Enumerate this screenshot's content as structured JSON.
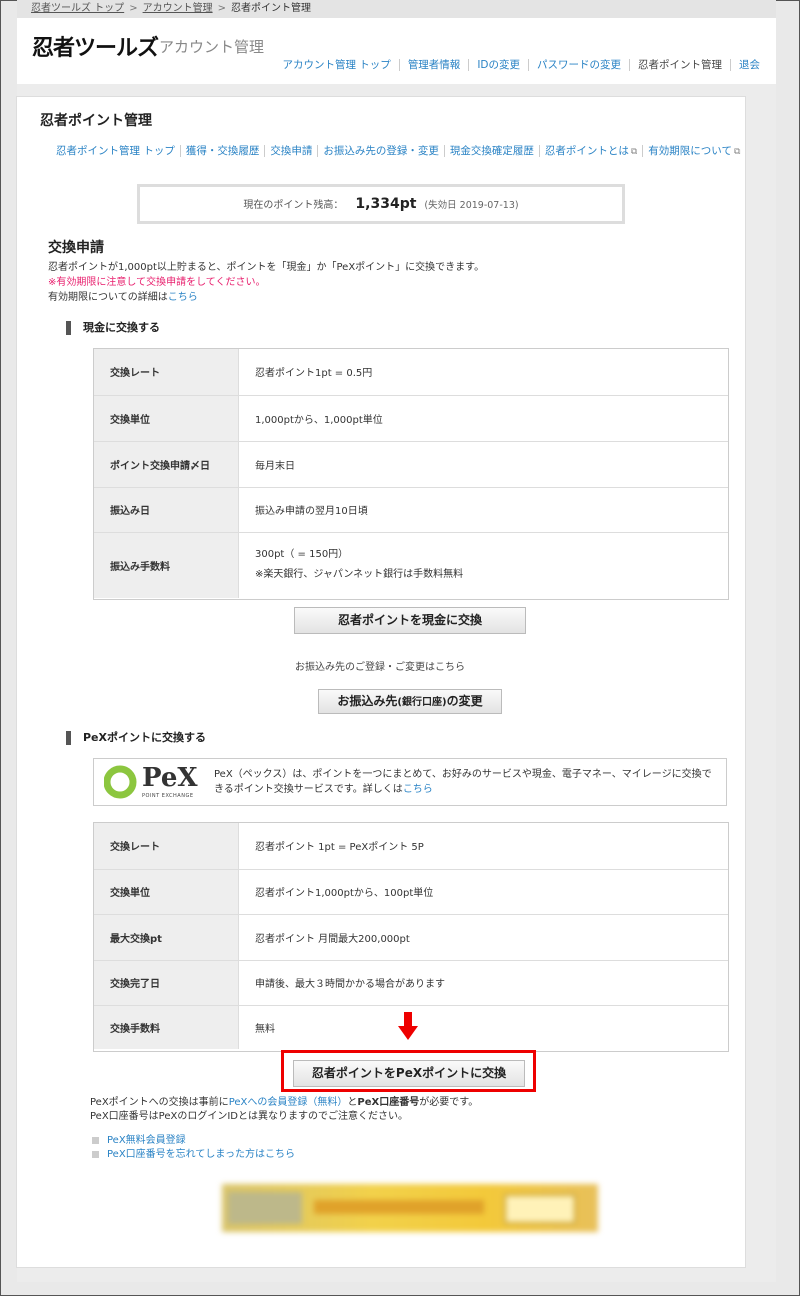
{
  "breadcrumb": {
    "items": [
      "忍者ツールズ トップ",
      "アカウント管理",
      "忍者ポイント管理"
    ],
    "sep": ">"
  },
  "header": {
    "logo": "忍者ツールズ",
    "subtitle": "アカウント管理",
    "nav": [
      "アカウント管理 トップ",
      "管理者情報",
      "IDの変更",
      "パスワードの変更",
      "忍者ポイント管理",
      "退会"
    ]
  },
  "panel": {
    "title": "忍者ポイント管理",
    "subnav": [
      "忍者ポイント管理 トップ",
      "獲得・交換履歴",
      "交換申請",
      "お振込み先の登録・変更",
      "現金交換確定履歴",
      "忍者ポイントとは",
      "有効期限について"
    ]
  },
  "balance": {
    "label": "現在のポイント残高：",
    "value": "1,334pt",
    "expiry": "(失効日 2019-07-13)"
  },
  "exchange": {
    "title": "交換申請",
    "intro1": "忍者ポイントが1,000pt以上貯まると、ポイントを「現金」か「PeXポイント」に交換できます。",
    "intro2": "※有効期限に注意して交換申請をしてください。",
    "intro3_prefix": "有効期限についての詳細は",
    "intro3_link": "こちら"
  },
  "cash": {
    "heading": "現金に交換する",
    "rows": [
      {
        "k": "交換レート",
        "v": "忍者ポイント1pt = 0.5円"
      },
      {
        "k": "交換単位",
        "v": "1,000ptから、1,000pt単位"
      },
      {
        "k": "ポイント交換申請〆日",
        "v": "毎月末日"
      },
      {
        "k": "振込み日",
        "v": "振込み申請の翌月10日頃"
      },
      {
        "k": "振込み手数料",
        "v": "300pt（ = 150円）",
        "v2": "※楽天銀行、ジャパンネット銀行は手数料無料"
      }
    ],
    "button": "忍者ポイントを現金に交換",
    "note": "お振込み先のご登録・ご変更はこちら",
    "button2_a": "お振込み先",
    "button2_b": "(銀行口座)",
    "button2_c": "の変更"
  },
  "pex": {
    "heading": "PeXポイントに交換する",
    "logo_text": "PeX",
    "logo_sub": "POINT EXCHANGE",
    "desc": "PeX（ペックス）は、ポイントを一つにまとめて、お好みのサービスや現金、電子マネー、マイレージに交換できるポイント交換サービスです。詳しくは",
    "desc_link": "こちら",
    "rows": [
      {
        "k": "交換レート",
        "v": "忍者ポイント 1pt = PeXポイント 5P"
      },
      {
        "k": "交換単位",
        "v": "忍者ポイント1,000ptから、100pt単位"
      },
      {
        "k": "最大交換pt",
        "v": "忍者ポイント 月間最大200,000pt"
      },
      {
        "k": "交換完了日",
        "v": "申請後、最大３時間かかる場合があります"
      },
      {
        "k": "交換手数料",
        "v": "無料"
      }
    ],
    "button": "忍者ポイントをPeXポイントに交換",
    "note1_a": "PeXポイントへの交換は事前に",
    "note1_link": "PeXへの会員登録（無料）",
    "note1_b": "と",
    "note1_bold": "PeX口座番号",
    "note1_c": "が必要です。",
    "note2": "PeX口座番号はPeXのログインIDとは異なりますのでご注意ください。",
    "links": [
      "PeX無料会員登録",
      "PeX口座番号を忘れてしまった方はこちら"
    ]
  },
  "colors": {
    "accent": "#2a83c5",
    "warning": "#e8206e",
    "highlight": "#ee0000",
    "pex_green": "#8cc63f"
  }
}
